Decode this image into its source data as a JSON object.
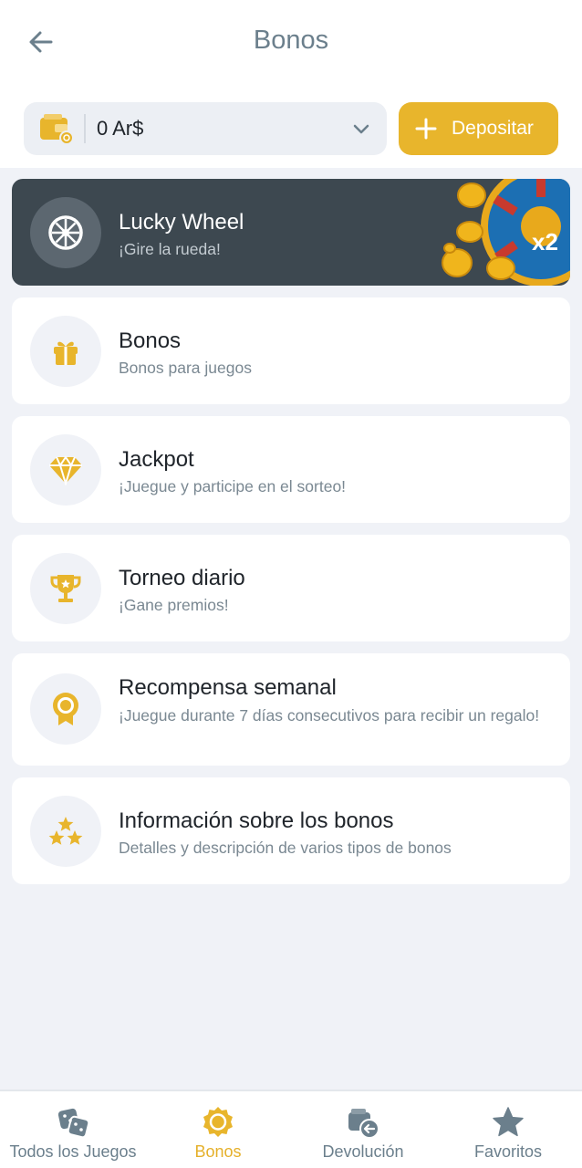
{
  "header": {
    "title": "Bonos",
    "back_icon": "arrow-left-icon"
  },
  "balance": {
    "value": "0 Ar$",
    "wallet_icon": "wallet-icon",
    "dropdown_icon": "chevron-down-icon"
  },
  "deposit": {
    "label": "Depositar",
    "icon": "plus-icon"
  },
  "colors": {
    "accent": "#e8b52c",
    "banner_bg": "#3d4850",
    "page_bg": "#f0f2f7",
    "muted_text": "#7a8892"
  },
  "cards": [
    {
      "title": "Lucky Wheel",
      "subtitle": "¡Gire la rueda!",
      "icon": "wheel-icon"
    },
    {
      "title": "Bonos",
      "subtitle": "Bonos para juegos",
      "icon": "gift-icon"
    },
    {
      "title": "Jackpot",
      "subtitle": "¡Juegue y participe en el sorteo!",
      "icon": "diamond-icon"
    },
    {
      "title": "Torneo diario",
      "subtitle": "¡Gane premios!",
      "icon": "trophy-icon"
    },
    {
      "title": "Recompensa semanal",
      "subtitle": "¡Juegue durante 7 días consecutivos para recibir un regalo!",
      "icon": "award-icon"
    },
    {
      "title": "Información sobre los bonos",
      "subtitle": "Detalles y descripción de varios tipos de bonos",
      "icon": "stars-icon"
    }
  ],
  "nav": [
    {
      "label": "Todos los Juegos",
      "icon": "dice-icon",
      "active": false
    },
    {
      "label": "Bonos",
      "icon": "bonus-badge-icon",
      "active": true
    },
    {
      "label": "Devolución",
      "icon": "cashback-icon",
      "active": false
    },
    {
      "label": "Favoritos",
      "icon": "star-icon",
      "active": false
    }
  ]
}
